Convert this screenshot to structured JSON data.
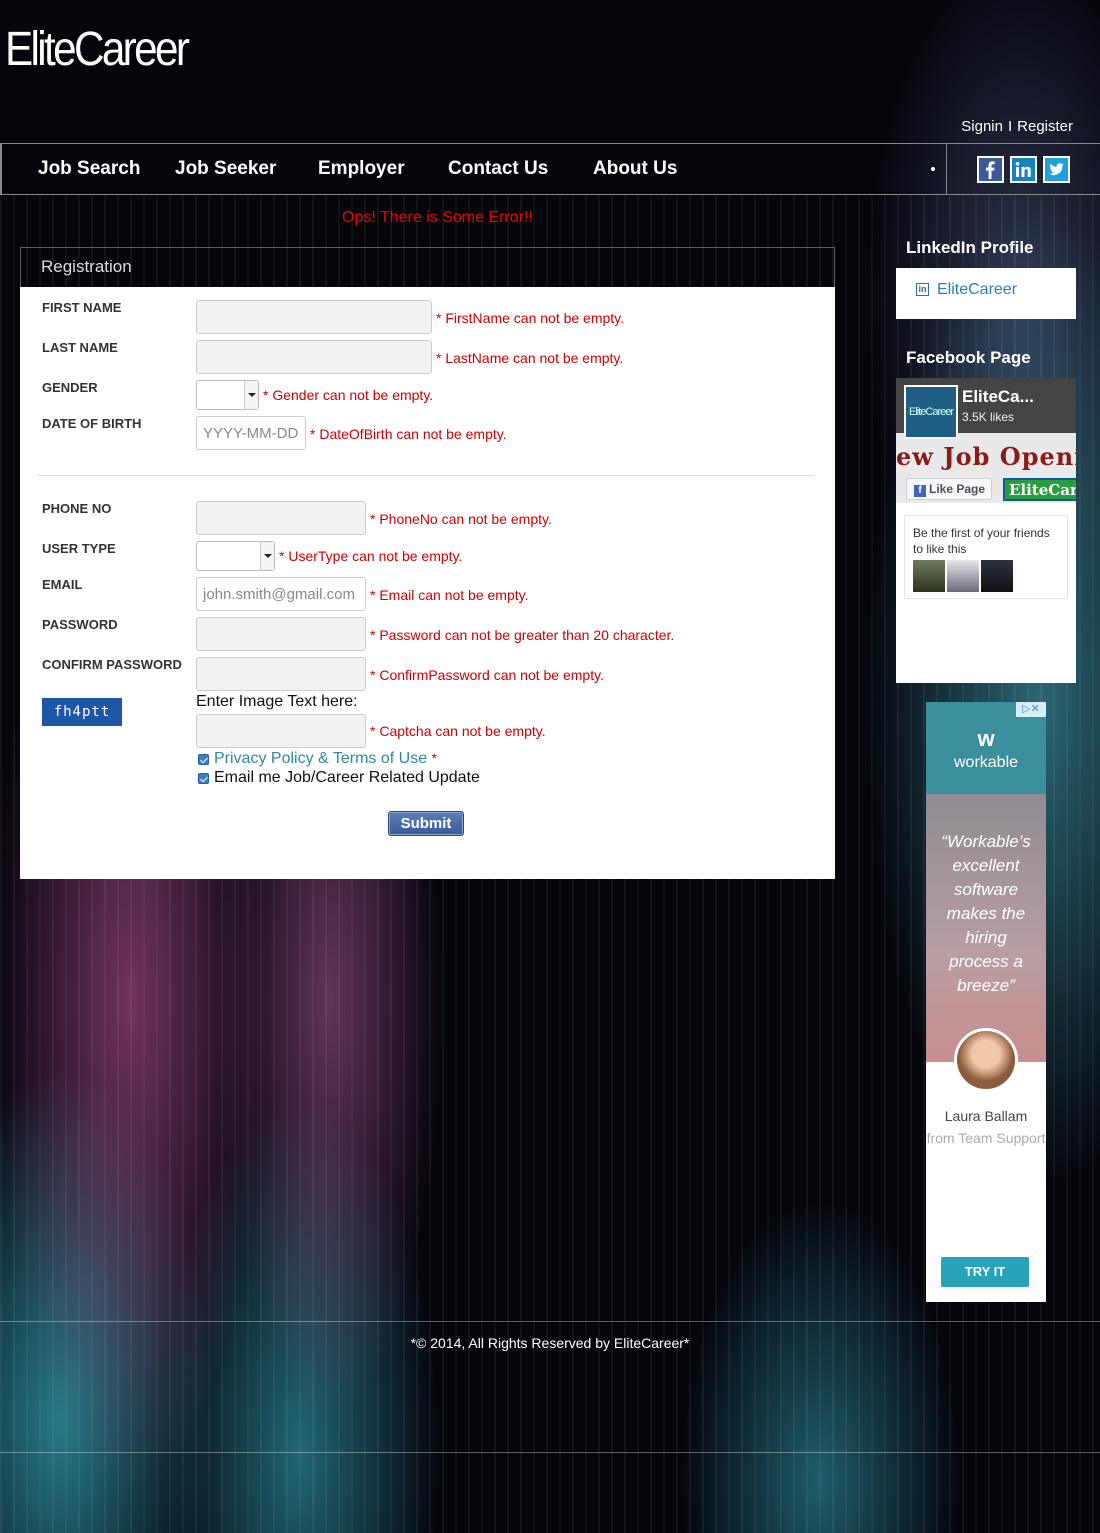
{
  "brand": {
    "logo": "EliteCareer"
  },
  "auth": {
    "signin": "Signin",
    "separator": "I",
    "register": "Register"
  },
  "nav": {
    "items": [
      "Job Search",
      "Job Seeker",
      "Employer",
      "Contact Us",
      "About Us"
    ],
    "social": [
      "facebook-icon",
      "linkedin-icon",
      "twitter-icon"
    ]
  },
  "error_banner": "Ops! There is Some Error!!",
  "form": {
    "title": "Registration",
    "fields": {
      "first_name": {
        "label": "FIRST NAME",
        "error": "* FirstName can not be empty."
      },
      "last_name": {
        "label": "LAST NAME",
        "error": "* LastName can not be empty."
      },
      "gender": {
        "label": "GENDER",
        "error": "* Gender can not be empty."
      },
      "dob": {
        "label": "DATE OF BIRTH",
        "placeholder": "YYYY-MM-DD",
        "error": "* DateOfBirth can not be empty."
      },
      "phone": {
        "label": "PHONE NO",
        "error": "* PhoneNo can not be empty."
      },
      "user_type": {
        "label": "USER TYPE",
        "error": "* UserType can not be empty."
      },
      "email": {
        "label": "EMAIL",
        "placeholder": "john.smith@gmail.com",
        "error": "* Email can not be empty."
      },
      "password": {
        "label": "PASSWORD",
        "error": "* Password can not be greater than 20 character."
      },
      "confirm_password": {
        "label": "CONFIRM PASSWORD",
        "error": "* ConfirmPassword can not be empty."
      },
      "captcha": {
        "image_text": "fh4ptt",
        "prompt": "Enter Image Text here:",
        "error": "* Captcha can not be empty."
      }
    },
    "checkboxes": {
      "privacy": {
        "label": "Privacy Policy & Terms of Use",
        "required_mark": "*",
        "checked": true
      },
      "updates": {
        "label": "Email me Job/Career Related Update",
        "checked": true
      }
    },
    "submit_label": "Submit"
  },
  "sidebar": {
    "linkedin": {
      "title": "LinkedIn Profile",
      "icon_text": "in",
      "name": "EliteCareer"
    },
    "facebook": {
      "title": "Facebook Page",
      "page_name": "EliteCa...",
      "thumb_text": "EliteCareer",
      "likes": "3.5K likes",
      "cover_text": "ew Job Openi",
      "like_button": "Like Page",
      "like_icon": "f",
      "cover_logo": "EliteCar",
      "friends_text": "Be the first of your friends to like this"
    }
  },
  "ad": {
    "close": "▷✕",
    "logo": "w",
    "brand": "workable",
    "quote": "“Workable’s excellent software makes the hiring process a breeze”",
    "person": "Laura Ballam",
    "person_sub": "from Team Support",
    "cta": "TRY IT"
  },
  "footer": {
    "copyright": "*© 2014, All Rights Reserved by EliteCareer*"
  }
}
